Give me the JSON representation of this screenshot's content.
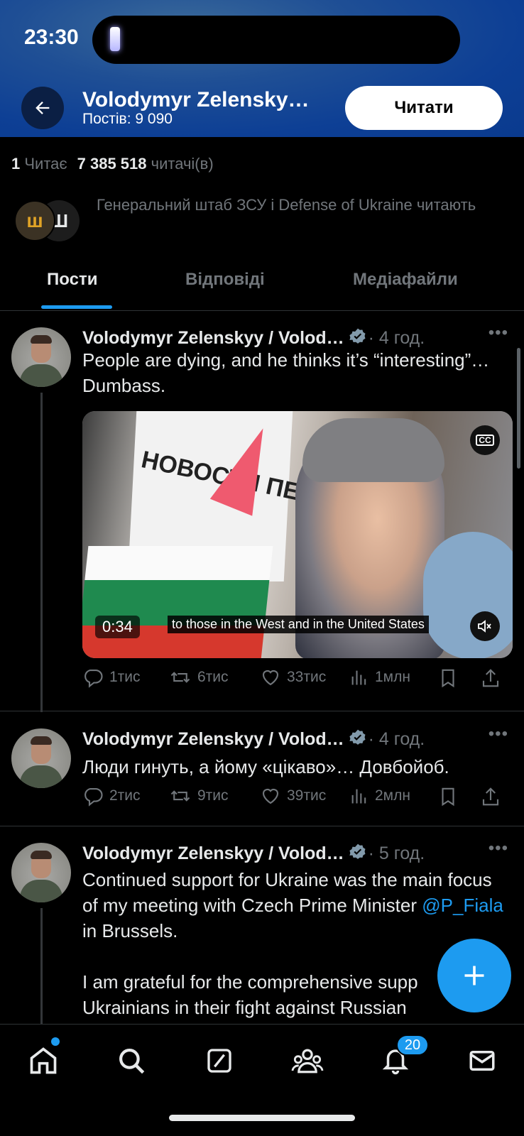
{
  "status_bar": {
    "time": "23:30"
  },
  "header": {
    "title": "Volodymyr Zelensky…",
    "posts_count": "Постів: 9 090",
    "follow_label": "Читати"
  },
  "stats": {
    "following_count": "1",
    "following_label": "Читає",
    "followers_count": "7 385 518",
    "followers_label": "читачі(в)"
  },
  "mutual": {
    "text": "Генеральний штаб ЗСУ і Defense of Ukraine читають"
  },
  "tabs": [
    "Пости",
    "Відповіді",
    "Медіафайли"
  ],
  "posts": [
    {
      "author": "Volodymyr Zelenskyy / Volod…",
      "time": "· 4 год.",
      "text": "People are dying, and he thinks it’s “interesting”… Dumbass.",
      "video": {
        "duration": "0:34",
        "caption": "to those in the West and in the United States",
        "sign_text": "НОВОСТИ ПЕРВЫХ"
      },
      "replies": "1тис",
      "reposts": "6тис",
      "likes": "33тис",
      "views": "1млн"
    },
    {
      "author": "Volodymyr Zelenskyy / Volod…",
      "time": "· 4 год.",
      "text": "Люди гинуть, а йому «цікаво»… Довбойоб.",
      "replies": "2тис",
      "reposts": "9тис",
      "likes": "39тис",
      "views": "2млн"
    },
    {
      "author": "Volodymyr Zelenskyy / Volod…",
      "time": "· 5 год.",
      "text_line1": "Continued support for Ukraine was the main focus of my meeting with Czech Prime Minister",
      "mention": "@P_Fiala",
      "text_line1_end": " in Brussels.",
      "text_line2": "I am grateful for the comprehensive supp",
      "text_line3": "Ukrainians in their fight against Russian"
    }
  ],
  "bottom_nav": {
    "notifications_badge": "20"
  },
  "colors": {
    "accent": "#1d9bf0",
    "header_bg": "#0d3f95",
    "background": "#000000"
  }
}
